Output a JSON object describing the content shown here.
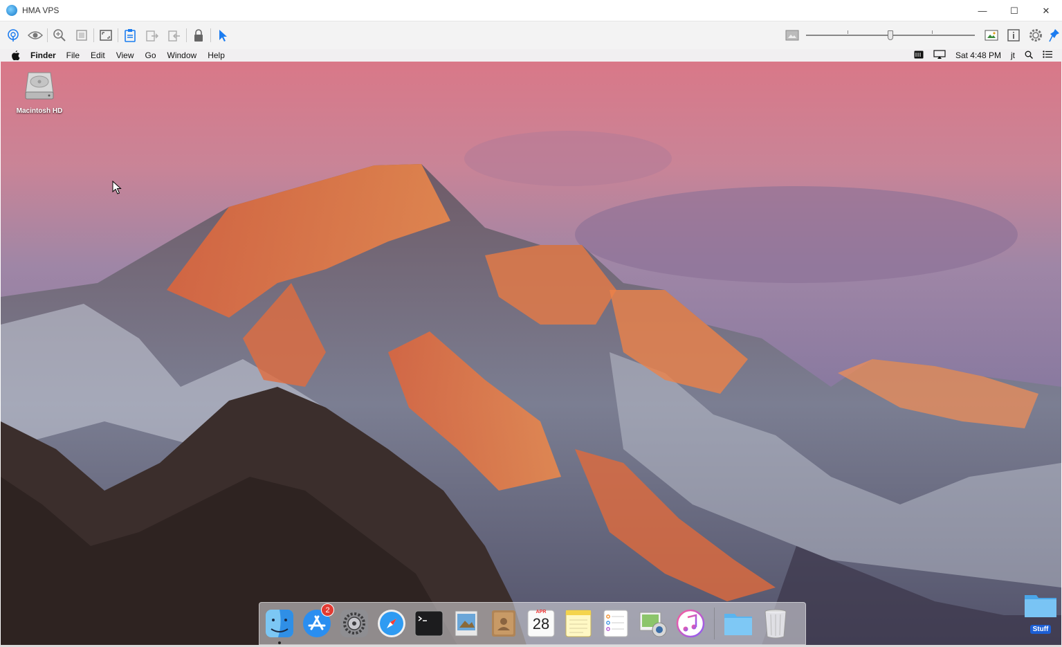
{
  "window": {
    "title": "HMA VPS",
    "controls": {
      "minimize": "—",
      "maximize": "☐",
      "close": "✕"
    }
  },
  "toolbar": {
    "left_icons": [
      "accessibility-icon",
      "eye-icon",
      "zoom-icon",
      "fit-screen-icon",
      "fullscreen-icon",
      "clipboard-icon",
      "send-file-icon",
      "receive-file-icon",
      "lock-icon",
      "pointer-icon"
    ],
    "right_icons": [
      "quality-low-icon",
      "quality-high-icon",
      "info-icon",
      "settings-icon",
      "pin-icon"
    ],
    "quality_slider": {
      "value": 0.5
    }
  },
  "menubar": {
    "app_name": "Finder",
    "items": [
      "File",
      "Edit",
      "View",
      "Go",
      "Window",
      "Help"
    ],
    "clock": "Sat 4:48 PM",
    "user": "jt"
  },
  "desktop": {
    "icons": [
      {
        "label": "Macintosh HD"
      }
    ],
    "stuff_folder": {
      "label": "Stuff"
    }
  },
  "dock": {
    "apps": [
      {
        "name": "finder-icon",
        "running": true
      },
      {
        "name": "app-store-icon",
        "badge": "2"
      },
      {
        "name": "system-preferences-icon"
      },
      {
        "name": "safari-icon"
      },
      {
        "name": "terminal-icon"
      },
      {
        "name": "preview-icon"
      },
      {
        "name": "contacts-icon"
      },
      {
        "name": "calendar-icon",
        "month": "APR",
        "day": "28"
      },
      {
        "name": "notes-icon"
      },
      {
        "name": "reminders-icon"
      },
      {
        "name": "photo-booth-icon"
      },
      {
        "name": "itunes-icon"
      }
    ],
    "extras": [
      "downloads-folder-icon",
      "trash-icon"
    ],
    "accent": "#1b7cf0"
  }
}
